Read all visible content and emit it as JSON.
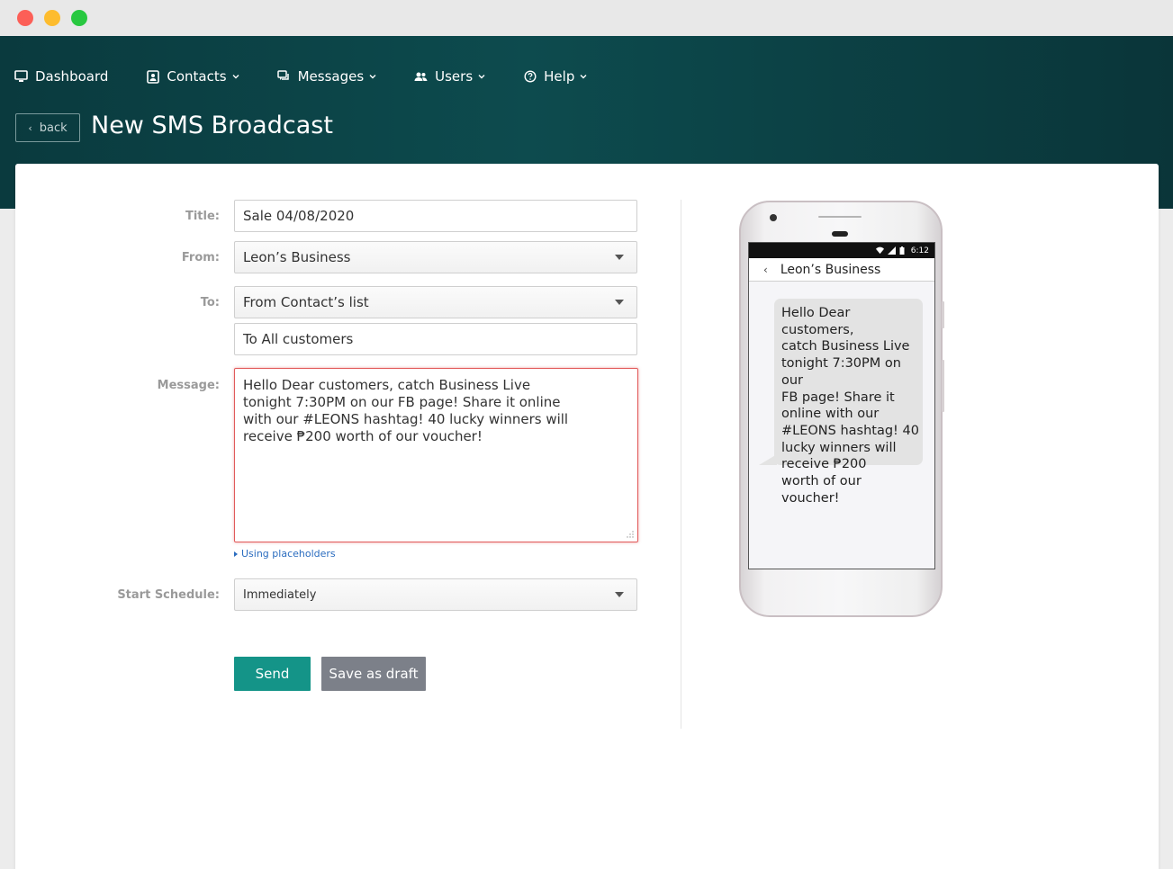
{
  "nav": {
    "items": [
      {
        "label": "Dashboard",
        "icon": "monitor-icon"
      },
      {
        "label": "Contacts",
        "icon": "contact-card-icon"
      },
      {
        "label": "Messages",
        "icon": "chat-bubbles-icon"
      },
      {
        "label": "Users",
        "icon": "users-icon"
      },
      {
        "label": "Help",
        "icon": "question-circle-icon"
      }
    ]
  },
  "header": {
    "back_label": "back",
    "title": "New SMS Broadcast"
  },
  "form": {
    "title_label": "Title:",
    "title_value": "Sale 04/08/2020",
    "from_label": "From:",
    "from_value": "Leon’s Business",
    "to_label": "To:",
    "to_value": "From Contact’s list",
    "to_group_value": "To All customers",
    "message_label": "Message:",
    "message_value": "Hello Dear customers, catch Business Live\ntonight 7:30PM on our FB page! Share it online\nwith our #LEONS hashtag! 40 lucky winners will\nreceive ₱200 worth of our voucher!",
    "placeholders_link": "Using placeholders",
    "schedule_label": "Start Schedule:",
    "schedule_value": "Immediately",
    "send_label": "Send",
    "draft_label": "Save as draft"
  },
  "preview": {
    "time": "6:12",
    "contact_name": "Leon’s Business",
    "bubble_text": "Hello Dear customers,\ncatch Business Live\ntonight 7:30PM on our\nFB page! Share it\nonline with our\n#LEONS hashtag! 40\nlucky winners will\nreceive ₱200\nworth of our voucher!"
  },
  "colors": {
    "header_bg": "#0d4b4e",
    "send_button": "#149488",
    "draft_button": "#7c8089",
    "message_border": "#e15a5a",
    "link": "#2a6cbf"
  }
}
